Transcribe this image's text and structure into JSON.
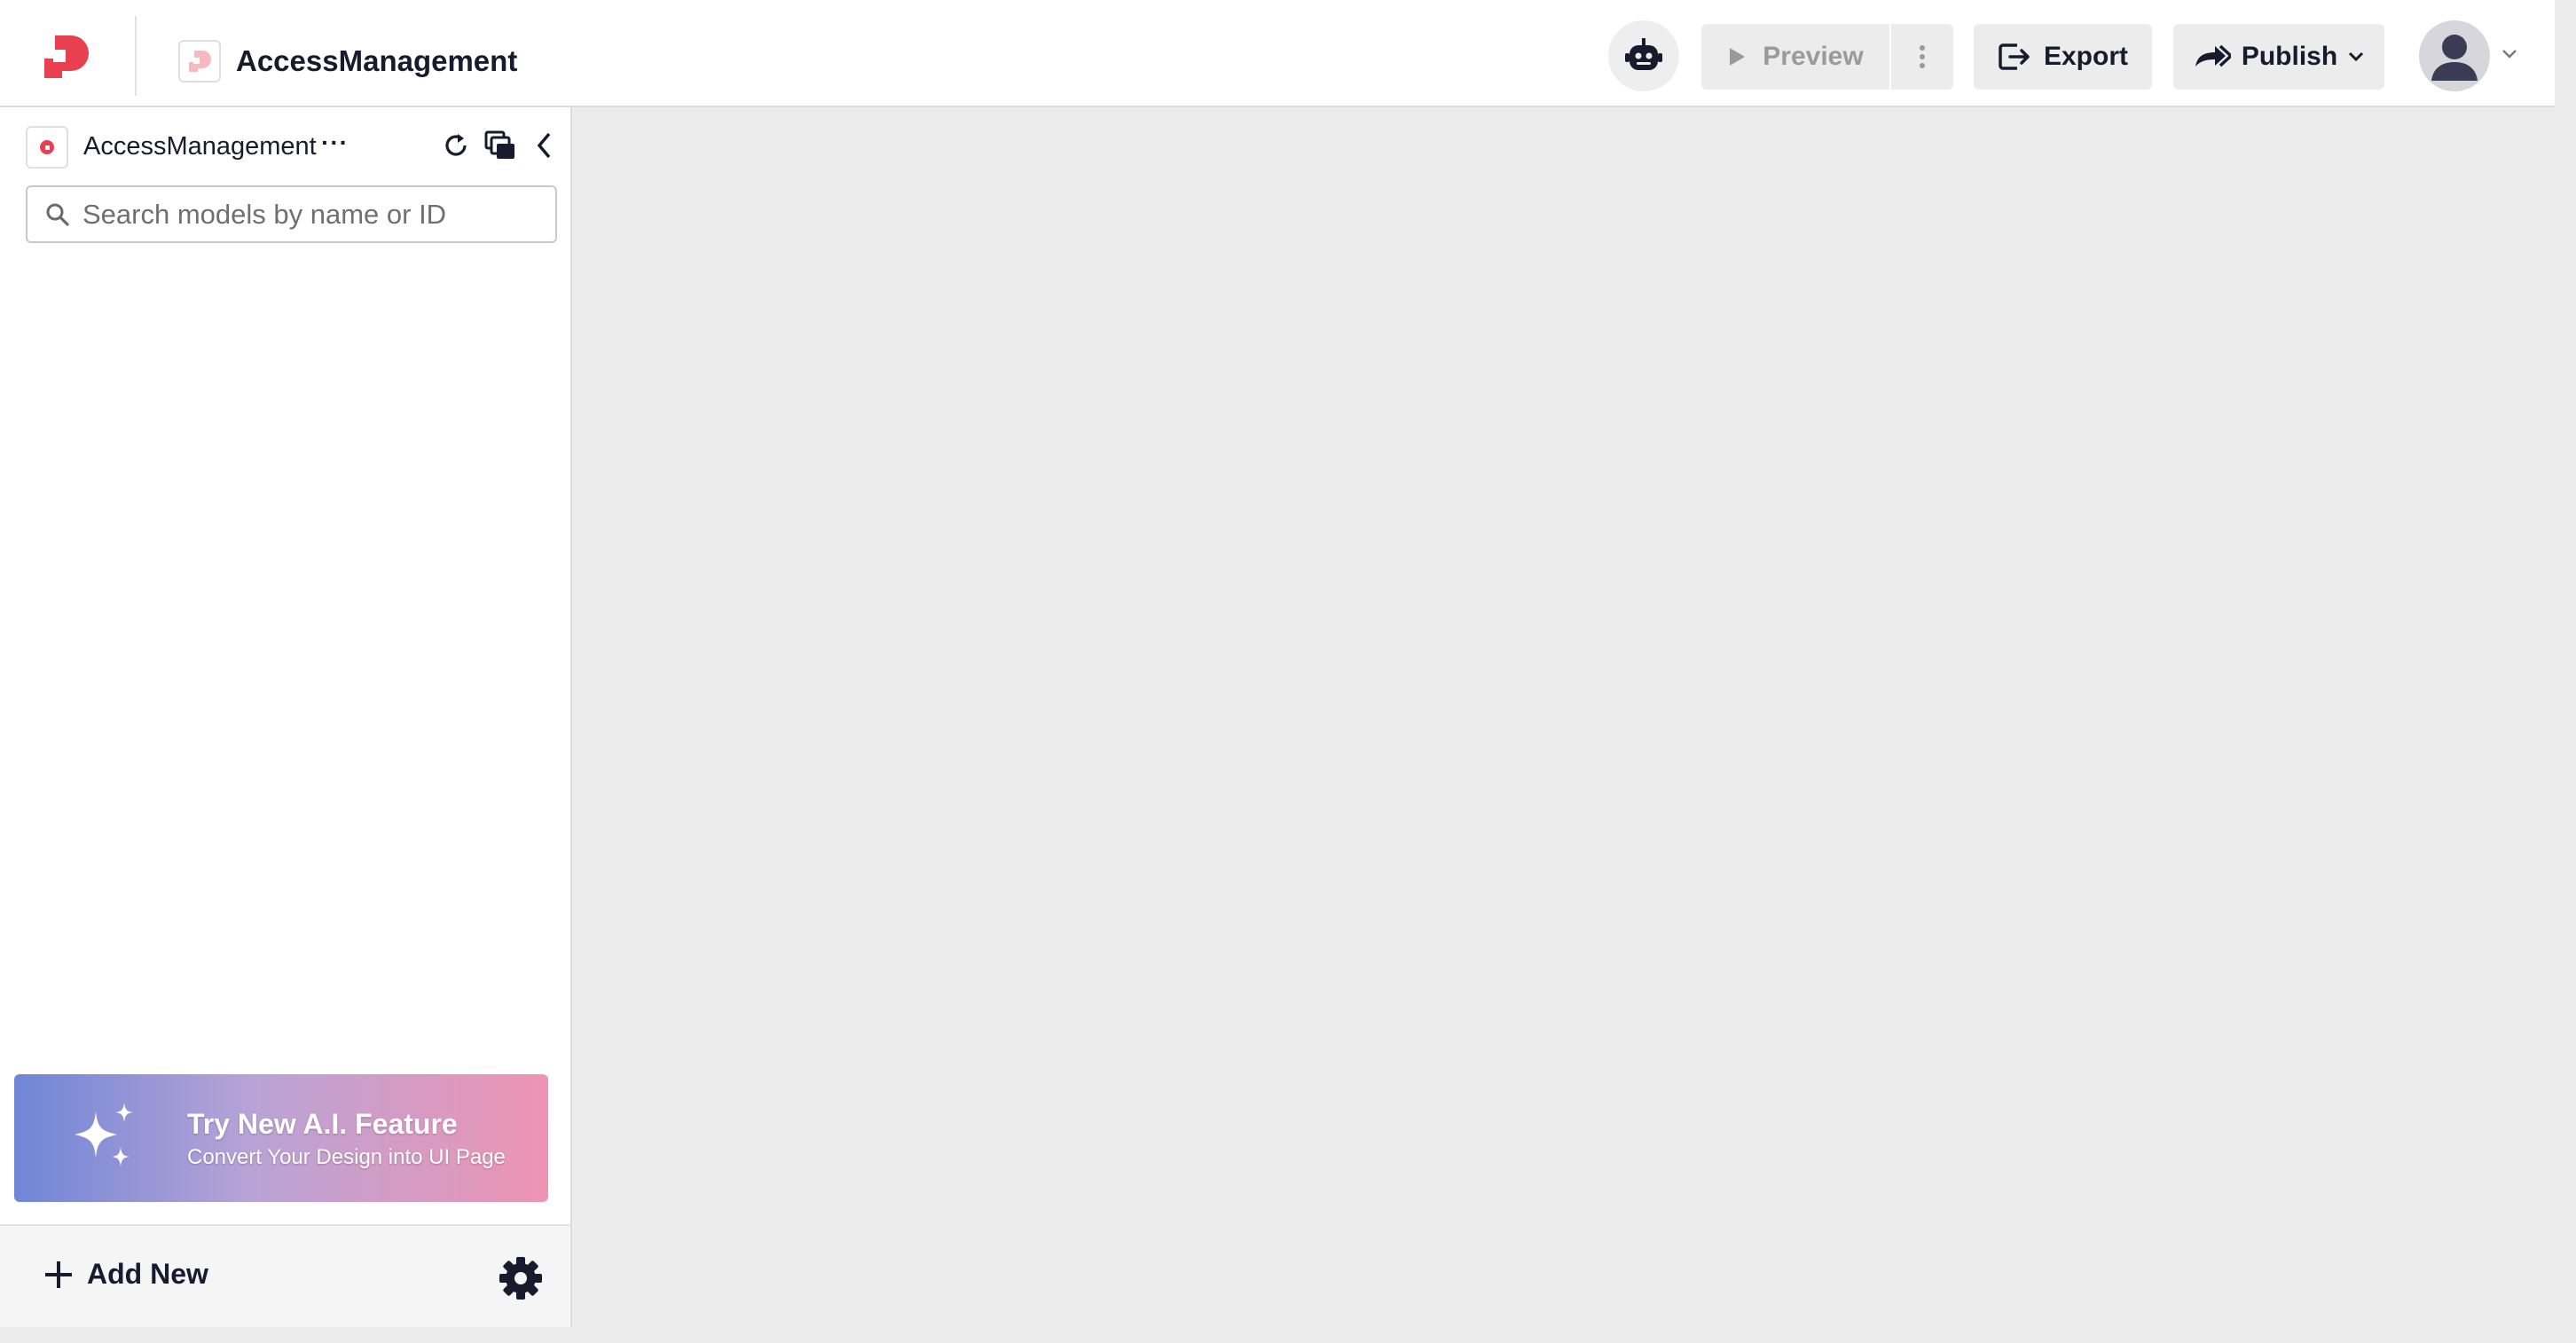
{
  "header": {
    "project_title": "AccessManagement",
    "preview_label": "Preview",
    "export_label": "Export",
    "publish_label": "Publish"
  },
  "sidebar": {
    "project_name": "AccessManagement",
    "more_label": "···",
    "search": {
      "placeholder": "Search models by name or ID",
      "value": ""
    }
  },
  "ai_banner": {
    "title": "Try New A.I. Feature",
    "subtitle": "Convert Your Design into UI Page"
  },
  "footer": {
    "add_new_label": "Add New"
  },
  "colors": {
    "brand_red": "#e8404f",
    "dark_text": "#1a1a2e",
    "disabled_text": "#9a9a9a",
    "canvas_bg": "#ececec",
    "banner_gradient": [
      "#6f86d6",
      "#b9a3d6",
      "#ee94b3"
    ]
  },
  "icons": {
    "logo": "app-logo",
    "bot": "robot-icon",
    "preview": "play-icon",
    "preview_more": "vertical-dots-icon",
    "export": "export-icon",
    "publish": "share-arrow-icon",
    "publish_menu": "chevron-down-icon",
    "avatar": "user-avatar",
    "refresh": "refresh-icon",
    "copy": "copy-icon",
    "collapse": "chevron-left-icon",
    "search": "search-icon",
    "sparkle": "sparkle-icon",
    "add": "plus-icon",
    "settings": "gear-icon"
  }
}
